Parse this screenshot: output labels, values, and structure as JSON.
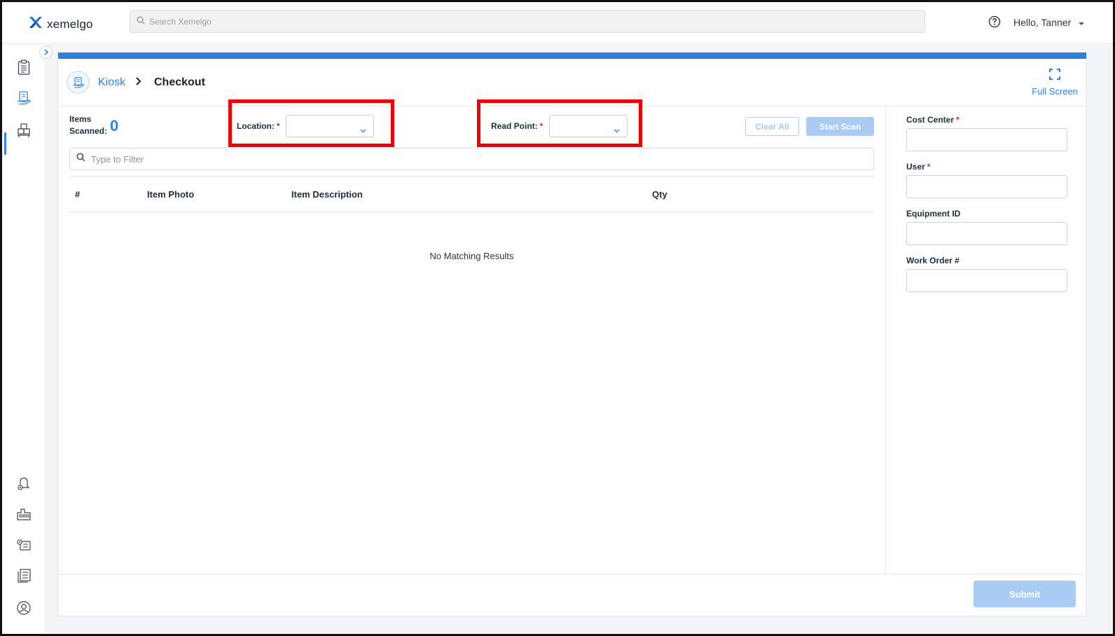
{
  "topbar": {
    "logo_text": "xemelgo",
    "search_placeholder": "Search Xemelgo",
    "greeting": "Hello, Tanner",
    "icons": {
      "logo": "xemelgo-logo-icon",
      "search": "search-icon",
      "help": "help-circle-icon",
      "user_menu": "caret-down-icon"
    }
  },
  "sidenav": {
    "top_items": [
      {
        "name": "clipboard-icon",
        "active": false
      },
      {
        "name": "kiosk-icon",
        "active": true
      },
      {
        "name": "boxes-icon",
        "active": false
      }
    ],
    "bottom_items": [
      {
        "name": "alert-settings-icon"
      },
      {
        "name": "factory-icon"
      },
      {
        "name": "settings-list-icon"
      },
      {
        "name": "report-list-icon"
      },
      {
        "name": "user-circle-icon"
      }
    ],
    "collapse_icon": "chevron-right-icon"
  },
  "header": {
    "breadcrumb_root": "Kiosk",
    "breadcrumb_current": "Checkout",
    "fullscreen_label": "Full Screen"
  },
  "controls": {
    "items_scanned_label": "Items Scanned:",
    "items_scanned_count": "0",
    "location_label": "Location:",
    "location_value": "",
    "read_point_label": "Read Point:",
    "read_point_value": "",
    "required_mark": "*",
    "clear_all": "Clear All",
    "start_scan": "Start Scan",
    "filter_placeholder": "Type to Filter"
  },
  "table": {
    "columns": [
      "#",
      "Item Photo",
      "Item Description",
      "Qty"
    ],
    "rows": [],
    "empty_message": "No Matching Results"
  },
  "form": {
    "fields": [
      {
        "label": "Cost Center",
        "required": "*",
        "value": ""
      },
      {
        "label": "User",
        "required": "*",
        "value": ""
      },
      {
        "label": "Equipment ID",
        "required": "",
        "value": ""
      },
      {
        "label": "Work Order #",
        "required": "",
        "value": ""
      }
    ],
    "submit": "Submit"
  },
  "colors": {
    "accent": "#2f80ed",
    "accent_bar": "#2e7fd9",
    "disabled_button": "#a9cbf6",
    "highlight": "#ee0000",
    "required": "#e02424"
  }
}
